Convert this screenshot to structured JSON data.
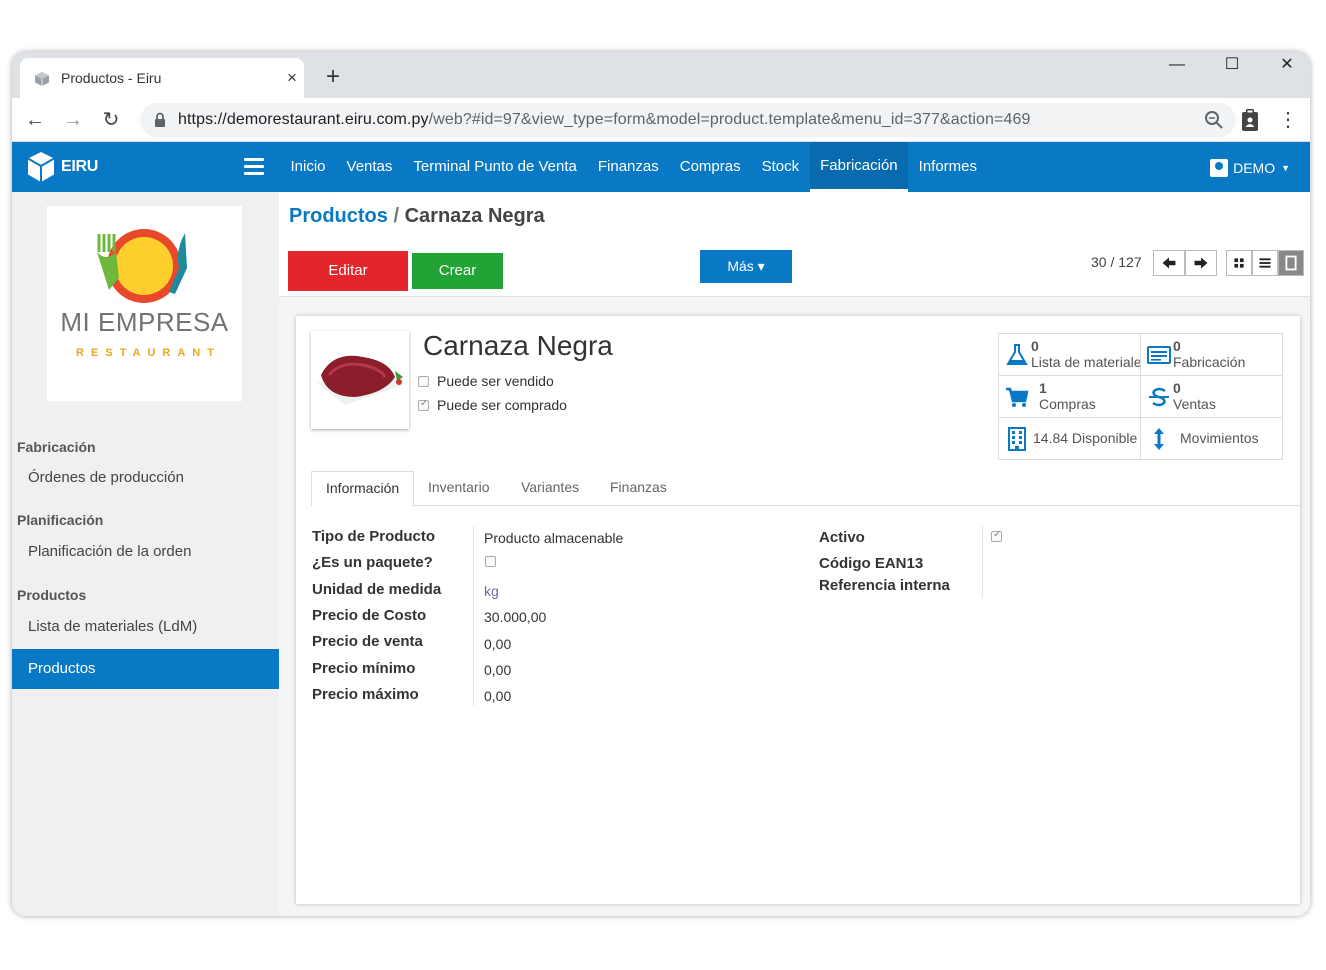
{
  "browser": {
    "tab_title": "Productos - Eiru",
    "tab_close": "×",
    "new_tab": "+",
    "url_host": "https://demorestaurant.eiru.com.py",
    "url_rest": "/web?#id=97&view_type=form&model=product.template&menu_id=377&action=469",
    "win_minimize": "—",
    "win_maximize": "☐",
    "win_close": "✕",
    "back": "←",
    "forward": "→",
    "reload": "↻",
    "menu_dots": "⋮"
  },
  "app": {
    "brand": "EIRU",
    "menu": [
      "Inicio",
      "Ventas",
      "Terminal Punto de Venta",
      "Finanzas",
      "Compras",
      "Stock",
      "Fabricación",
      "Informes"
    ],
    "active_menu": "Fabricación",
    "user": "DEMO"
  },
  "sidebar": {
    "company_name": "MI EMPRESA",
    "company_sub": "RESTAURANT",
    "sections": [
      {
        "title": "Fabricación",
        "items": [
          "Órdenes de producción"
        ]
      },
      {
        "title": "Planificación",
        "items": [
          "Planificación de la orden"
        ]
      },
      {
        "title": "Productos",
        "items": [
          "Lista de materiales (LdM)",
          "Productos"
        ]
      }
    ],
    "active_item": "Productos"
  },
  "control_panel": {
    "breadcrumb_parent": "Productos",
    "breadcrumb_sep": "/",
    "breadcrumb_current": "Carnaza Negra",
    "edit_label": "Editar",
    "create_label": "Crear",
    "more_label": "Más ▾",
    "pager": "30 / 127"
  },
  "product": {
    "name": "Carnaza Negra",
    "can_be_sold_label": "Puede ser vendido",
    "can_be_sold": false,
    "can_be_purchased_label": "Puede ser comprado",
    "can_be_purchased": true,
    "stats": [
      {
        "value": "0",
        "label": "Lista de materiales",
        "icon": "flask-icon"
      },
      {
        "value": "0",
        "label": "Fabricación",
        "icon": "list-icon"
      },
      {
        "value": "1",
        "label": "Compras",
        "icon": "cart-icon"
      },
      {
        "value": "0",
        "label": "Ventas",
        "icon": "currency-icon"
      },
      {
        "value": "",
        "label": "14.84 Disponible",
        "icon": "building-icon"
      },
      {
        "value": "",
        "label": "Movimientos",
        "icon": "arrows-vertical-icon"
      }
    ]
  },
  "tabs": [
    "Información",
    "Inventario",
    "Variantes",
    "Finanzas"
  ],
  "active_tab": "Información",
  "fields_left": [
    {
      "label": "Tipo de Producto",
      "value": "Producto almacenable"
    },
    {
      "label": "¿Es un paquete?",
      "value": ""
    },
    {
      "label": "Unidad de medida",
      "value": "kg"
    },
    {
      "label": "Precio de Costo",
      "value": "30.000,00"
    },
    {
      "label": "Precio de venta",
      "value": "0,00"
    },
    {
      "label": "Precio mínimo",
      "value": "0,00"
    },
    {
      "label": "Precio máximo",
      "value": "0,00"
    }
  ],
  "fields_right": [
    {
      "label": "Activo",
      "value": ""
    },
    {
      "label": "Código EAN13",
      "value": ""
    },
    {
      "label": "Referencia interna",
      "value": ""
    }
  ],
  "colors": {
    "primary": "#0a79c5",
    "edit": "#e3262b",
    "create": "#21a336",
    "sidebar_bg": "#f0f0f0"
  }
}
